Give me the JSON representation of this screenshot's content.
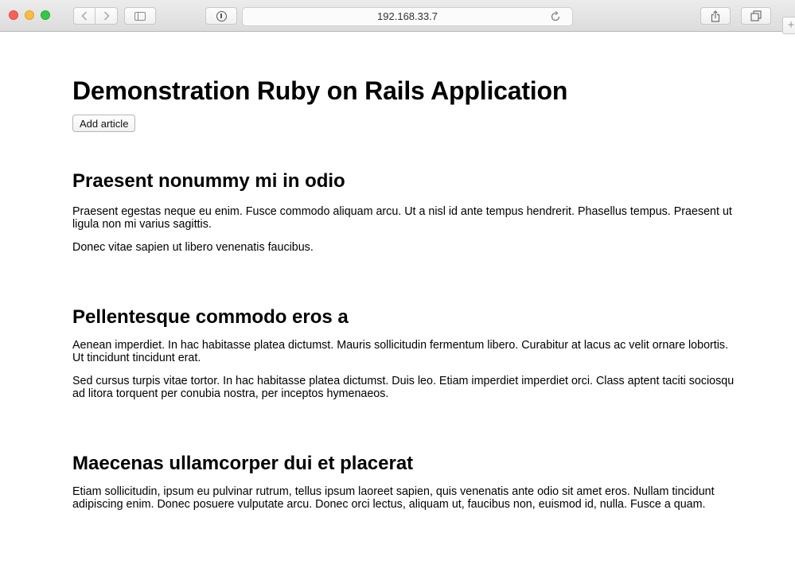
{
  "browser": {
    "url": "192.168.33.7",
    "colors": {
      "close": "#fc605c",
      "minimize": "#fdbc40",
      "zoom": "#34c84a"
    },
    "icons": {
      "back": "chevron-left-icon",
      "forward": "chevron-right-icon",
      "sidebar": "sidebar-icon",
      "privacy": "privacy-icon",
      "reload": "reload-icon",
      "share": "share-icon",
      "tabs": "tabs-overview-icon",
      "new_tab": "plus-icon"
    }
  },
  "page": {
    "title": "Demonstration Ruby on Rails Application",
    "add_article_label": "Add article",
    "articles": [
      {
        "title": "Praesent nonummy mi in odio",
        "paragraphs": [
          "Praesent egestas neque eu enim. Fusce commodo aliquam arcu. Ut a nisl id ante tempus hendrerit. Phasellus tempus. Praesent ut ligula non mi varius sagittis.",
          "Donec vitae sapien ut libero venenatis faucibus."
        ]
      },
      {
        "title": "Pellentesque commodo eros a",
        "paragraphs": [
          "Aenean imperdiet. In hac habitasse platea dictumst. Mauris sollicitudin fermentum libero. Curabitur at lacus ac velit ornare lobortis. Ut tincidunt tincidunt erat.",
          "Sed cursus turpis vitae tortor. In hac habitasse platea dictumst. Duis leo. Etiam imperdiet imperdiet orci. Class aptent taciti sociosqu ad litora torquent per conubia nostra, per inceptos hymenaeos."
        ]
      },
      {
        "title": "Maecenas ullamcorper dui et placerat",
        "paragraphs": [
          "Etiam sollicitudin, ipsum eu pulvinar rutrum, tellus ipsum laoreet sapien, quis venenatis ante odio sit amet eros. Nullam tincidunt adipiscing enim. Donec posuere vulputate arcu. Donec orci lectus, aliquam ut, faucibus non, euismod id, nulla. Fusce a quam."
        ]
      }
    ]
  }
}
